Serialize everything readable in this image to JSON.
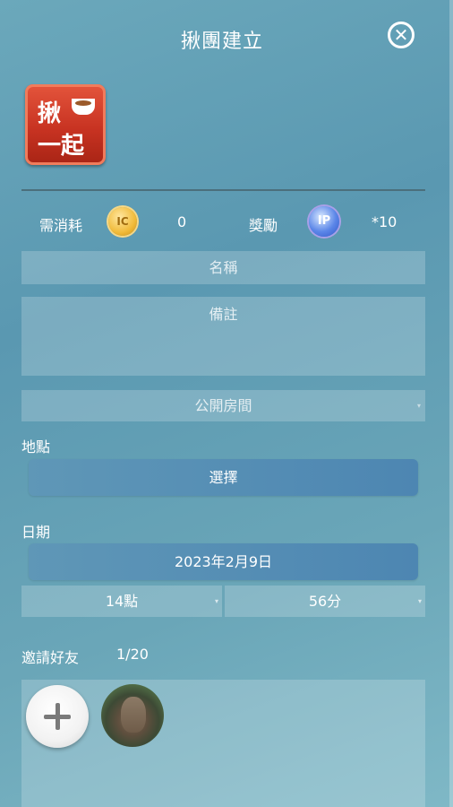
{
  "header": {
    "title": "揪團建立",
    "close_icon": "close-circle-icon"
  },
  "logo": {
    "line1": "揪",
    "line2": "一起",
    "icon": "coffee-cup-icon"
  },
  "cost": {
    "cost_label": "需消耗",
    "coin_icon": "coin-icon",
    "coin_text": "IC",
    "cost_value": "0",
    "reward_label": "獎勵",
    "reward_icon": "ip-badge-icon",
    "reward_badge_text": "IP",
    "reward_value": "*10"
  },
  "form": {
    "name_placeholder": "名稱",
    "note_placeholder": "備註",
    "room_type": "公開房間"
  },
  "location": {
    "label": "地點",
    "button": "選擇"
  },
  "date": {
    "label": "日期",
    "value": "2023年2月9日",
    "hour": "14點",
    "minute": "56分"
  },
  "invite": {
    "label": "邀請好友",
    "count": "1/20",
    "add_icon": "plus-icon"
  },
  "colors": {
    "button": "#5b93b6",
    "background": "#6aa6b8"
  }
}
